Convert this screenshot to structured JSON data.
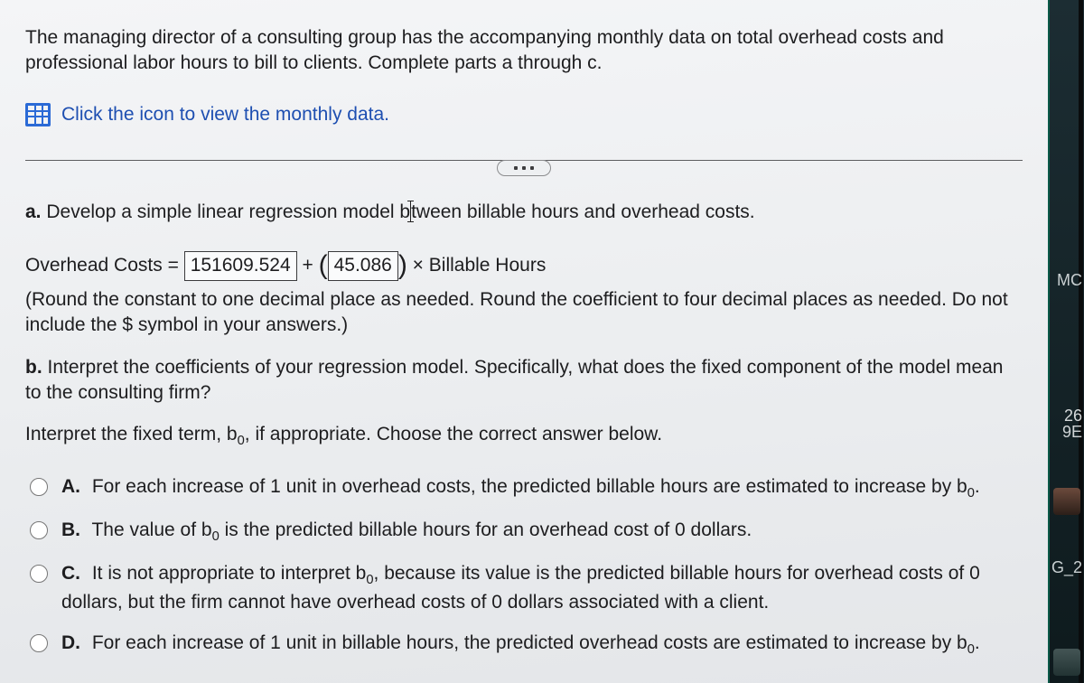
{
  "intro": {
    "text": "The managing director of a consulting group has the accompanying monthly data on total overhead costs and professional labor hours to bill to clients. Complete parts a through c."
  },
  "data_link": {
    "label": "Click the icon to view the monthly data."
  },
  "part_a": {
    "label": "a.",
    "prompt_before": "Develop a simple linear regression model b",
    "prompt_after": "tween billable hours and overhead costs.",
    "eq_lhs": "Overhead Costs =",
    "constant": "151609.524",
    "plus": "+",
    "coefficient": "45.086",
    "eq_tail": "× Billable Hours",
    "hint": "(Round the constant to one decimal place as needed. Round the coefficient to four decimal places as needed. Do not include the $ symbol in your answers.)"
  },
  "part_b": {
    "label": "b.",
    "prompt": "Interpret the coefficients of your regression model. Specifically, what does the fixed component of the model mean to the consulting firm?"
  },
  "interpret": {
    "before": "Interpret the fixed term, b",
    "sub": "0",
    "after": ", if appropriate. Choose the correct answer below."
  },
  "choices": {
    "a": {
      "letter": "A.",
      "before": "For each increase of 1 unit in overhead costs, the predicted billable hours are estimated to increase by b",
      "sub": "0",
      "after": "."
    },
    "b": {
      "letter": "B.",
      "before": "The value of b",
      "sub": "0",
      "after": " is the predicted billable hours for an overhead cost of 0 dollars."
    },
    "c": {
      "letter": "C.",
      "before": "It is not appropriate to interpret b",
      "sub": "0",
      "after": ", because its value is the predicted billable hours for  overhead costs of 0 dollars, but the firm cannot have overhead costs of 0 dollars associated with a client."
    },
    "d": {
      "letter": "D.",
      "before": "For each increase of 1 unit in billable hours, the predicted overhead costs are estimated to increase by b",
      "sub": "0",
      "after": "."
    }
  },
  "right_fragments": {
    "f1": "MC",
    "f2": "26",
    "f3": "9E",
    "f4": "G_2"
  }
}
